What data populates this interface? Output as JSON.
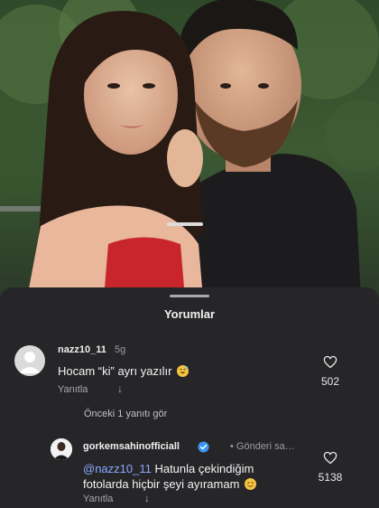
{
  "sheet": {
    "title": "Yorumlar"
  },
  "comments": [
    {
      "username": "nazz10_11",
      "time": "5g",
      "text": "Hocam “ki” ayrı yazılır",
      "emoji": "grinning-sweat-emoji",
      "reply_label": "Yanıtla",
      "likes": "502",
      "view_replies": "Önceki 1 yanıtı gör"
    },
    {
      "username": "gorkemsahinofficiall",
      "verified": true,
      "meta": "• Gönderi sa…",
      "mention": "@nazz10_11",
      "text_line1": " Hatunla çekindiğim",
      "text_line2": "fotolarda hiçbir şeyi ayıramam",
      "emoji": "smiling-blush-emoji",
      "reply_label": "Yanıtla",
      "likes": "5138"
    }
  ],
  "colors": {
    "background": "#262629",
    "text": "#f4f4f4",
    "muted": "#9c9ca2",
    "mention": "#8aa8ff",
    "verified": "#3797f0"
  },
  "icons": [
    "heart-icon",
    "translate-arrow-icon",
    "verified-badge-icon",
    "default-avatar-icon"
  ]
}
